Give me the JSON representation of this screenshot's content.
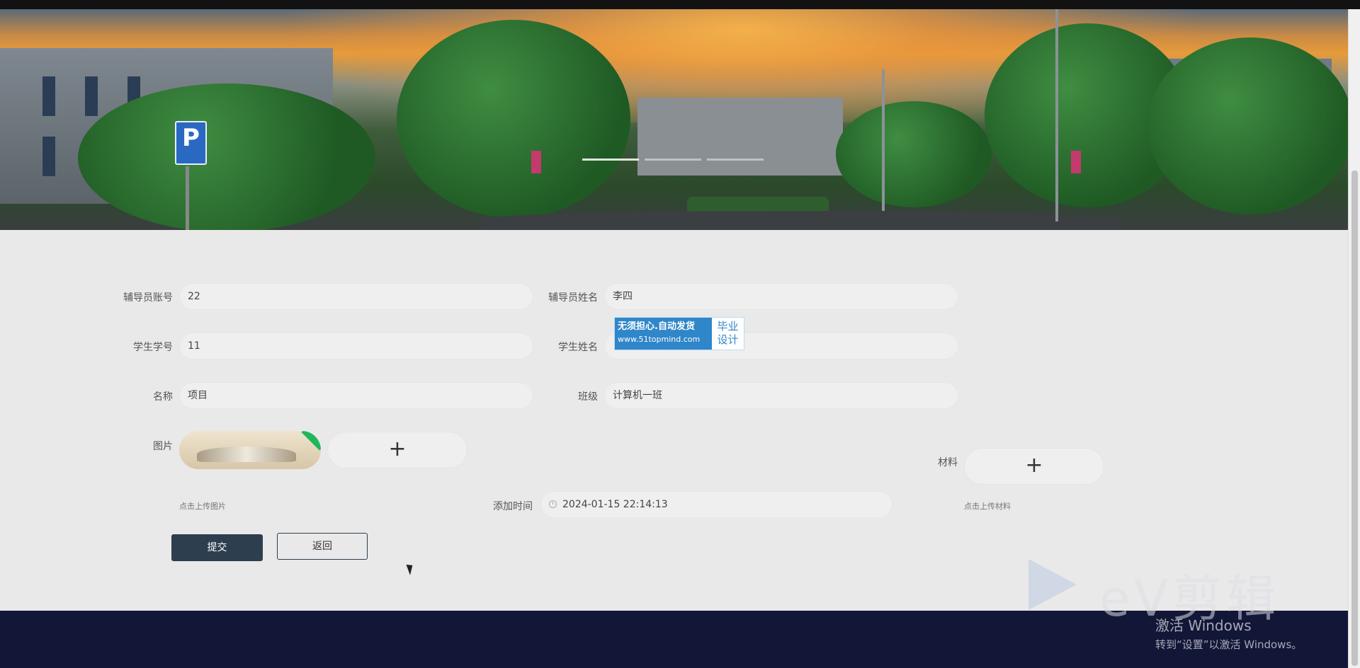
{
  "form": {
    "counselor_account": {
      "label": "辅导员账号",
      "value": "22"
    },
    "counselor_name": {
      "label": "辅导员姓名",
      "value": "李四"
    },
    "student_id": {
      "label": "学生学号",
      "value": "11"
    },
    "student_name": {
      "label": "学生姓名",
      "value": ""
    },
    "name": {
      "label": "名称",
      "value": "项目"
    },
    "class": {
      "label": "班级",
      "value": "计算机一班"
    },
    "image": {
      "label": "图片",
      "add_symbol": "+",
      "hint": "点击上传图片"
    },
    "add_time": {
      "label": "添加时间",
      "value": "2024-01-15 22:14:13"
    },
    "material": {
      "label": "材料",
      "add_symbol": "+",
      "hint": "点击上传材料"
    }
  },
  "buttons": {
    "submit": "提交",
    "back": "返回"
  },
  "overlay_ad": {
    "line1": "无须担心.自动发货",
    "line2": "www.51topmind.com",
    "tag1": "毕业",
    "tag2": "设计"
  },
  "watermark": {
    "logo_text": "eV剪辑"
  },
  "windows_activation": {
    "title": "激活 Windows",
    "subtitle": "转到“设置”以激活 Windows。"
  },
  "carousel": {
    "slides": 3,
    "active_index": 0
  },
  "icons": {
    "clock": "clock-icon",
    "cursor": "mouse-cursor-icon"
  },
  "colors": {
    "button_primary": "#2d3e4f",
    "footer": "#121738",
    "upload_badge": "#1fb75c"
  }
}
